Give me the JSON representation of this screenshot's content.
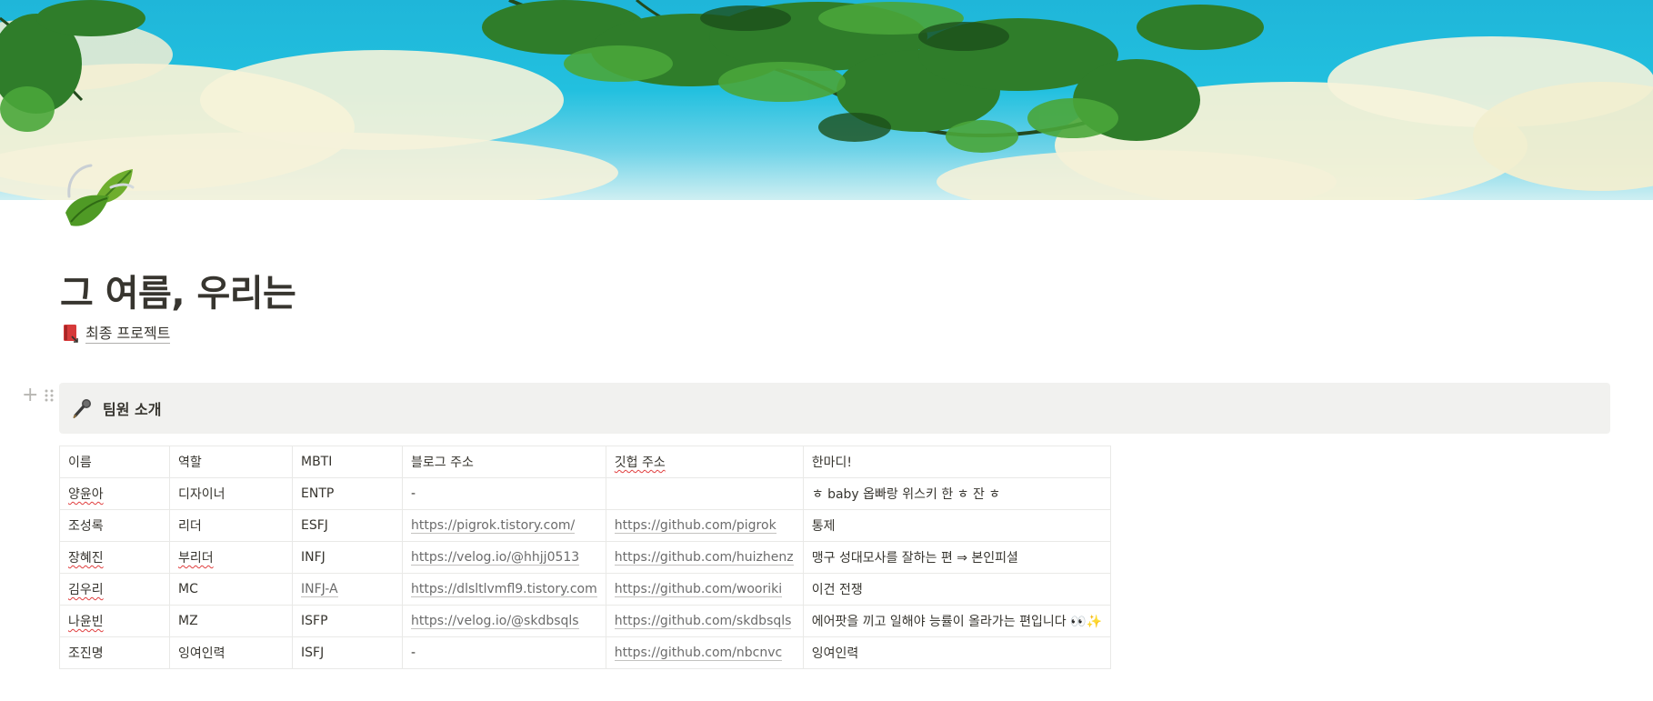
{
  "page": {
    "title": "그 여름, 우리는",
    "link_label": "최종 프로젝트",
    "cover_colors": {
      "sky": "#1fb6d9",
      "cloud": "#f3f1d6",
      "leaf": "#2f7d2a"
    }
  },
  "callout": {
    "title": "팀원 소개"
  },
  "table": {
    "headers": [
      "이름",
      "역할",
      "MBTI",
      "블로그 주소",
      "깃헙 주소",
      "한마디!"
    ],
    "rows": [
      [
        "양윤아",
        "디자이너",
        "ENTP",
        "-",
        "",
        "ㅎ baby 옵빠랑 위스키 한 ㅎ 잔 ㅎ"
      ],
      [
        "조성록",
        "리더",
        "ESFJ",
        "https://pigrok.tistory.com/",
        "https://github.com/pigrok",
        "통제"
      ],
      [
        "장혜진",
        "부리더",
        "INFJ",
        "https://velog.io/@hhjj0513",
        "https://github.com/huizhenz",
        "맹구 성대모사를 잘하는 편 ⇒ 본인피셜"
      ],
      [
        "김우리",
        "MC",
        "INFJ-A",
        "https://dlsltlvmfl9.tistory.com",
        "https://github.com/wooriki",
        "이건 전쟁"
      ],
      [
        "나윤빈",
        "MZ",
        "ISFP",
        "https://velog.io/@skdbsqls",
        "https://github.com/skdbsqls",
        "에어팟을 끼고 일해야 능률이 올라가는 편입니다 👀✨"
      ],
      [
        "조진명",
        "잉여인력",
        "ISFJ",
        "-",
        "https://github.com/nbcnvc",
        "잉여인력"
      ]
    ]
  }
}
